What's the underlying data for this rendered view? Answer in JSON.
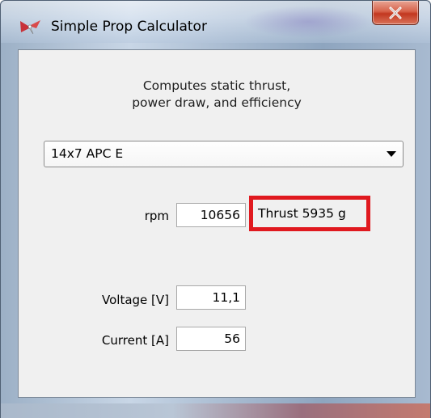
{
  "window": {
    "title": "Simple Prop Calculator",
    "close_icon": "close-x-icon",
    "app_icon": "propeller-icon"
  },
  "description": {
    "line1": "Computes static thrust,",
    "line2": "power draw, and efficiency"
  },
  "propeller_select": {
    "selected": "14x7 APC E"
  },
  "rpm": {
    "label": "rpm",
    "value": "10656"
  },
  "thrust": {
    "text": "Thrust 5935 g",
    "highlight_color": "#e0191f"
  },
  "voltage": {
    "label": "Voltage [V]",
    "value": "11,1"
  },
  "current": {
    "label": "Current [A]",
    "value": "56"
  }
}
